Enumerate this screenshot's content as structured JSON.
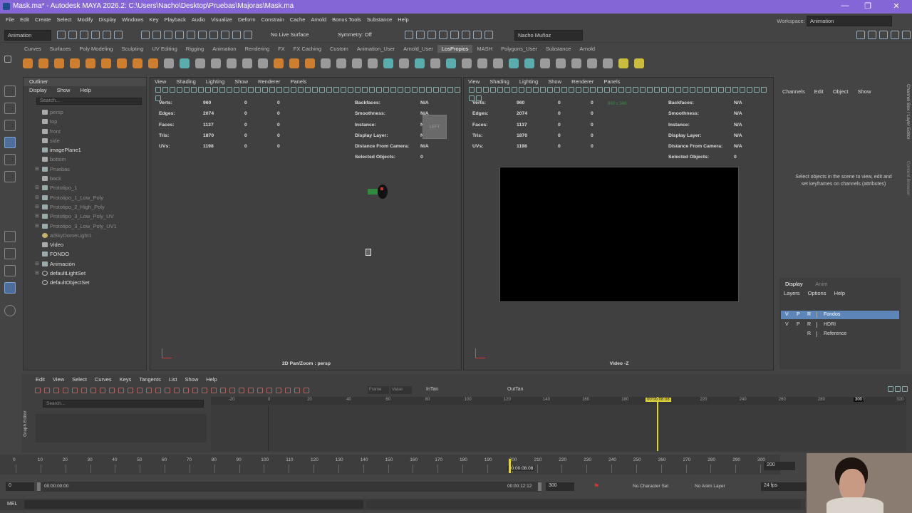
{
  "window": {
    "title": "Mask.ma* - Autodesk MAYA 2026.2: C:\\Users\\Nacho\\Desktop\\Pruebas\\Majoras\\Mask.ma",
    "controls": [
      "—",
      "❐",
      "✕"
    ]
  },
  "menubar": {
    "items": [
      "File",
      "Edit",
      "Create",
      "Select",
      "Modify",
      "Display",
      "Windows",
      "Key",
      "Playback",
      "Audio",
      "Visualize",
      "Deform",
      "Constrain",
      "Cache",
      "Arnold",
      "Bonus Tools",
      "Substance",
      "Help"
    ],
    "workspace_label": "Workspace:",
    "workspace_value": "Animation"
  },
  "statusline": {
    "menuset": "Animation",
    "live_surface": "No Live Surface",
    "symmetry": "Symmetry: Off",
    "user": "Nacho Muñoz"
  },
  "shelf": {
    "tabs": [
      "Curves",
      "Surfaces",
      "Poly Modeling",
      "Sculpting",
      "UV Editing",
      "Rigging",
      "Animation",
      "Rendering",
      "FX",
      "FX Caching",
      "Custom",
      "Animation_User",
      "Arnold_User",
      "LosPropios",
      "MASH",
      "Polygons_User",
      "Substance",
      "Arnold"
    ],
    "active_tab": "LosPropios",
    "icon_colors": [
      "#e7882a",
      "#e7882a",
      "#e7882a",
      "#e7882a",
      "#e7882a",
      "#e7882a",
      "#e7882a",
      "#e7882a",
      "#e7882a",
      "#aaaaaa",
      "#5ec0c0",
      "#aaaaaa",
      "#aaaaaa",
      "#aaaaaa",
      "#aaaaaa",
      "#aaaaaa",
      "#e7882a",
      "#e7882a",
      "#e7882a",
      "#aaaaaa",
      "#aaaaaa",
      "#aaaaaa",
      "#aaaaaa",
      "#5ec0c0",
      "#aaaaaa",
      "#5ec0c0",
      "#aaaaaa",
      "#5ec0c0",
      "#aaaaaa",
      "#aaaaaa",
      "#aaaaaa",
      "#5ec0c0",
      "#5ec0c0",
      "#aaaaaa",
      "#aaaaaa",
      "#aaaaaa",
      "#aaaaaa",
      "#aaaaaa",
      "#e0d23a",
      "#e0d23a"
    ]
  },
  "outliner": {
    "title": "Outliner",
    "menu": [
      "Display",
      "Show",
      "Help"
    ],
    "search_placeholder": "Search...",
    "items": [
      {
        "label": "persp",
        "dim": true,
        "icon": "cam",
        "exp": ""
      },
      {
        "label": "top",
        "dim": true,
        "icon": "cam",
        "exp": ""
      },
      {
        "label": "front",
        "dim": true,
        "icon": "cam",
        "exp": ""
      },
      {
        "label": "side",
        "dim": true,
        "icon": "cam",
        "exp": ""
      },
      {
        "label": "imagePlane1",
        "dim": false,
        "icon": "img",
        "exp": ""
      },
      {
        "label": "bottom",
        "dim": true,
        "icon": "cam",
        "exp": ""
      },
      {
        "label": "Pruebas",
        "dim": true,
        "icon": "grp",
        "exp": "⊞"
      },
      {
        "label": "back",
        "dim": true,
        "icon": "cam",
        "exp": ""
      },
      {
        "label": "Prototipo_1",
        "dim": true,
        "icon": "grp",
        "exp": "⊞"
      },
      {
        "label": "Prototipo_1_Low_Poly",
        "dim": true,
        "icon": "grp",
        "exp": "⊞"
      },
      {
        "label": "Prototipo_2_High_Poly",
        "dim": true,
        "icon": "grp",
        "exp": "⊞"
      },
      {
        "label": "Prototipo_3_Low_Poly_UV",
        "dim": true,
        "icon": "grp",
        "exp": "⊞"
      },
      {
        "label": "Prototipo_3_Low_Poly_UV1",
        "dim": true,
        "icon": "grp",
        "exp": "⊞"
      },
      {
        "label": "aiSkyDomeLight1",
        "dim": true,
        "icon": "light",
        "exp": ""
      },
      {
        "label": "Video",
        "dim": false,
        "icon": "cam",
        "exp": ""
      },
      {
        "label": "FONDO",
        "dim": false,
        "icon": "grp",
        "exp": ""
      },
      {
        "label": "Animación",
        "dim": false,
        "icon": "grp",
        "exp": "⊞"
      },
      {
        "label": "defaultLightSet",
        "dim": false,
        "icon": "set",
        "exp": "⊞"
      },
      {
        "label": "defaultObjectSet",
        "dim": false,
        "icon": "set",
        "exp": ""
      }
    ]
  },
  "viewport_left": {
    "menu": [
      "View",
      "Shading",
      "Lighting",
      "Show",
      "Renderer",
      "Panels"
    ],
    "hud_left": [
      [
        "Verts:",
        "960",
        "0",
        "0"
      ],
      [
        "Edges:",
        "2074",
        "0",
        "0"
      ],
      [
        "Faces:",
        "1137",
        "0",
        "0"
      ],
      [
        "Tris:",
        "1870",
        "0",
        "0"
      ],
      [
        "UVs:",
        "1198",
        "0",
        "0"
      ]
    ],
    "hud_right": [
      [
        "Backfaces:",
        "N/A"
      ],
      [
        "Smoothness:",
        "N/A"
      ],
      [
        "Instance:",
        "N/A"
      ],
      [
        "Display Layer:",
        "N/A"
      ],
      [
        "Distance From Camera:",
        "N/A"
      ],
      [
        "Selected Objects:",
        "0"
      ]
    ],
    "cube_label": "LEFT",
    "name": "2D Pan/Zoom : persp"
  },
  "viewport_right": {
    "menu": [
      "View",
      "Shading",
      "Lighting",
      "Show",
      "Renderer",
      "Panels"
    ],
    "resolution": "960 x 540",
    "hud_left": [
      [
        "Verts:",
        "960",
        "0",
        "0"
      ],
      [
        "Edges:",
        "2074",
        "0",
        "0"
      ],
      [
        "Faces:",
        "1137",
        "0",
        "0"
      ],
      [
        "Tris:",
        "1870",
        "0",
        "0"
      ],
      [
        "UVs:",
        "1198",
        "0",
        "0"
      ]
    ],
    "hud_right": [
      [
        "Backfaces:",
        "N/A"
      ],
      [
        "Smoothness:",
        "N/A"
      ],
      [
        "Instance:",
        "N/A"
      ],
      [
        "Display Layer:",
        "N/A"
      ],
      [
        "Distance From Camera:",
        "N/A"
      ],
      [
        "Selected Objects:",
        "0"
      ]
    ],
    "name": "Video -Z"
  },
  "channelbox": {
    "menu": [
      "Channels",
      "Edit",
      "Object",
      "Show"
    ],
    "message": "Select objects in the scene to view, edit and set keyframes on channels (attributes)",
    "side_tab_1": "Channel Box / Layer Editor",
    "side_tab_2": "Content Browser"
  },
  "layers": {
    "tabs": [
      "Display",
      "Anim"
    ],
    "menu": [
      "Layers",
      "Options",
      "Help"
    ],
    "rows": [
      {
        "v": "V",
        "p": "P",
        "r": "R",
        "name": "Fondos",
        "selected": true
      },
      {
        "v": "V",
        "p": "P",
        "r": "R",
        "name": "HDRI",
        "selected": false
      },
      {
        "v": "",
        "p": "",
        "r": "R",
        "name": "Reference",
        "selected": false
      }
    ]
  },
  "graph_editor": {
    "side_label": "Graph Editor",
    "menu": [
      "Edit",
      "View",
      "Select",
      "Curves",
      "Keys",
      "Tangents",
      "List",
      "Show",
      "Help"
    ],
    "frame_label": "Frame",
    "value_label": "Value",
    "intan": "InTan",
    "outtan": "OutTan",
    "search_placeholder": "Search...",
    "ruler": [
      "-20",
      "0",
      "20",
      "40",
      "60",
      "80",
      "100",
      "120",
      "140",
      "160",
      "180",
      "200",
      "220",
      "240",
      "260",
      "280",
      "300",
      "320"
    ],
    "current_time": "00:00:08:08",
    "end_marker": "300"
  },
  "timeslider": {
    "ticks": [
      "0",
      "10",
      "20",
      "30",
      "40",
      "50",
      "60",
      "70",
      "80",
      "90",
      "100",
      "110",
      "120",
      "130",
      "140",
      "150",
      "160",
      "170",
      "180",
      "190",
      "200",
      "210",
      "220",
      "230",
      "240",
      "250",
      "260",
      "270",
      "280",
      "290",
      "300"
    ],
    "current": "00:00:08:08",
    "frame_field": "200"
  },
  "rangeslider": {
    "start": "0",
    "start_time": "00:00:00:00",
    "end_time": "00:00:12:12",
    "end": "300",
    "char_set": "No Character Set",
    "anim_layer": "No Anim Layer",
    "fps": "24 fps"
  },
  "cmdline": {
    "label": "MEL"
  }
}
